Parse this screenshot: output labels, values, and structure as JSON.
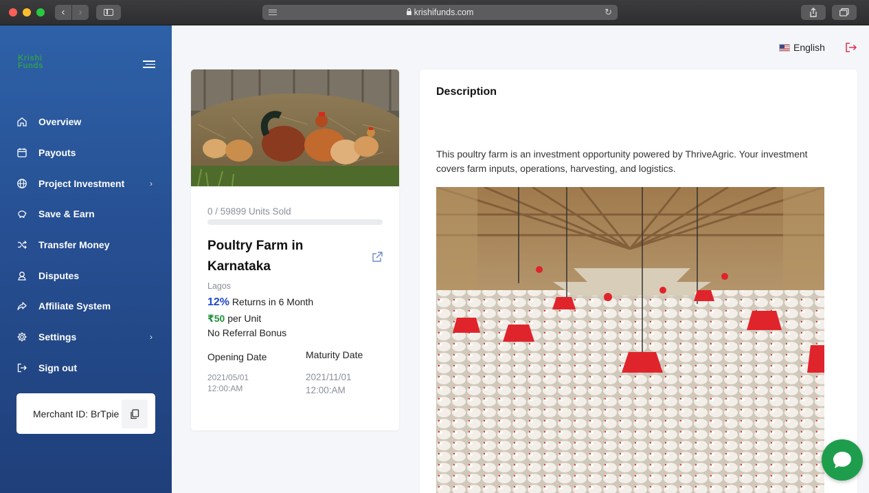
{
  "browser": {
    "url": "krishifunds.com",
    "back_icon": "chevron-left-icon",
    "forward_icon": "chevron-right-icon"
  },
  "sidebar": {
    "logo_line1": "Krishi",
    "logo_line2": "Funds",
    "items": [
      {
        "label": "Overview",
        "icon": "home-icon",
        "has_submenu": false
      },
      {
        "label": "Payouts",
        "icon": "calendar-icon",
        "has_submenu": false
      },
      {
        "label": "Project Investment",
        "icon": "globe-icon",
        "has_submenu": true
      },
      {
        "label": "Save & Earn",
        "icon": "piggy-bank-icon",
        "has_submenu": false
      },
      {
        "label": "Transfer Money",
        "icon": "shuffle-icon",
        "has_submenu": false
      },
      {
        "label": "Disputes",
        "icon": "user-badge-icon",
        "has_submenu": false
      },
      {
        "label": "Affiliate System",
        "icon": "share-icon",
        "has_submenu": false
      },
      {
        "label": "Settings",
        "icon": "gear-icon",
        "has_submenu": true
      },
      {
        "label": "Sign out",
        "icon": "sign-out-icon",
        "has_submenu": false
      }
    ],
    "merchant_id": "Merchant ID: BrTpie"
  },
  "header": {
    "language": "English"
  },
  "project": {
    "units_sold_text": "0 / 59899 Units Sold",
    "units_sold_fraction": 0,
    "title": "Poultry Farm in Karnataka",
    "location": "Lagos",
    "returns_pct": "12%",
    "returns_text": " Returns in 6 Month",
    "price": "₹50",
    "price_suffix": " per Unit",
    "referral": "No Referral Bonus",
    "opening_label": "Opening Date",
    "opening_date": "2021/05/01",
    "opening_time": "12:00:AM",
    "maturity_label": "Maturity Date",
    "maturity_date": "2021/11/01",
    "maturity_time": "12:00:AM"
  },
  "description": {
    "title": "Description",
    "text": "This poultry farm is an investment opportunity powered by ThriveAgric. Your investment covers farm inputs, operations, harvesting, and logistics."
  },
  "colors": {
    "sidebar_top": "#2e61a8",
    "sidebar_bottom": "#1f3f7a",
    "accent_blue": "#2048c8",
    "price_green": "#1e8f3a",
    "chat_green": "#1e9e4c",
    "logout_red": "#d9314a"
  }
}
